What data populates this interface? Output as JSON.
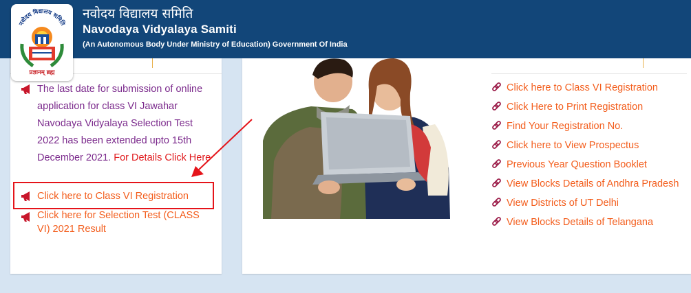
{
  "header": {
    "title_hindi": "नवोदय विद्यालय समिति",
    "title_english": "Navodaya Vidyalaya Samiti",
    "subtitle": "(An Autonomous Body Under Ministry of Education) Government Of India",
    "logo": {
      "name": "nvs-logo",
      "text_top": "नवोदय विद्यालय समिति",
      "text_bottom": "प्रज्ञानम् ब्रह्म"
    }
  },
  "notices": [
    {
      "icon": "megaphone-icon",
      "text": "The last date for submission of online application for class VI Jawahar Navodaya Vidyalaya Selection Test 2022 has been extended upto 15th December 2021.",
      "link": "For Details Click Here"
    },
    {
      "icon": "megaphone-icon",
      "text": "Click here to Class VI Registration"
    },
    {
      "icon": "megaphone-icon",
      "text": "Click here for Selection Test (CLASS VI) 2021 Result"
    }
  ],
  "links": [
    {
      "icon": "link-icon",
      "label": "Click here to Class VI Registration"
    },
    {
      "icon": "link-icon",
      "label": "Click Here to Print Registration"
    },
    {
      "icon": "link-icon",
      "label": "Find Your Registration No."
    },
    {
      "icon": "link-icon",
      "label": "Click here to View Prospectus"
    },
    {
      "icon": "link-icon",
      "label": "Previous Year Question Booklet"
    },
    {
      "icon": "link-icon",
      "label": "View Blocks Details of Andhra Pradesh"
    },
    {
      "icon": "link-icon",
      "label": "View Districts of UT Delhi"
    },
    {
      "icon": "link-icon",
      "label": "View Blocks Details of Telangana"
    }
  ],
  "image": {
    "name": "students-with-laptop-photo"
  },
  "colors": {
    "header": "#124679",
    "link_orange": "#f35d1c",
    "notice_purple": "#7b2a8c",
    "details_red": "#e0191c",
    "annotation_red": "#e5141a",
    "background": "#d6e4f2"
  }
}
